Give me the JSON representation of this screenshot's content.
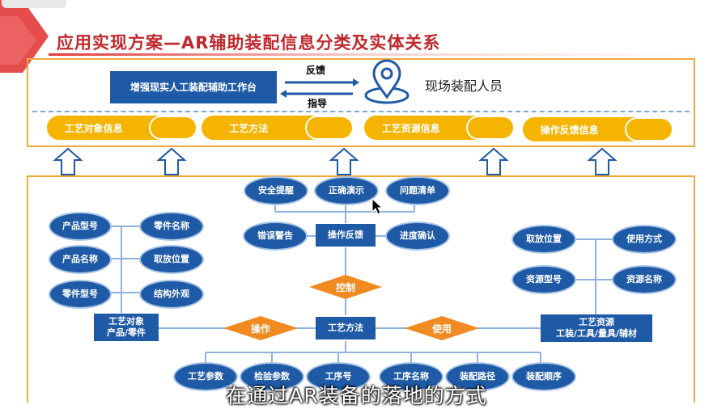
{
  "slide": {
    "title": "应用实现方案—AR辅助装配信息分类及实体关系",
    "subtitle": "在通过AR装备的落地的方式"
  },
  "top": {
    "workstation": "增强现实人工装配辅助工作台",
    "feedback": "反馈",
    "guide": "指导",
    "personnel": "现场装配人员",
    "pills": [
      "工艺对象信息",
      "工艺方法",
      "工艺资源信息",
      "操作反馈信息"
    ]
  },
  "feedback_cluster": {
    "center": "操作反馈",
    "safety": [
      "安全",
      "提醒"
    ],
    "demo": [
      "正确",
      "演示"
    ],
    "issues": [
      "问题",
      "清单"
    ],
    "error": [
      "错误",
      "警告"
    ],
    "progress": [
      "进度",
      "确认"
    ]
  },
  "object_cluster": {
    "center": [
      "工艺对象",
      "产品/零件"
    ],
    "product_model": [
      "产品",
      "型号"
    ],
    "product_name": [
      "产品",
      "名称"
    ],
    "part_model": [
      "零件",
      "型号"
    ],
    "part_name": [
      "零件",
      "名称"
    ],
    "pick_position": [
      "取放",
      "位置"
    ],
    "structure": [
      "结构",
      "外观"
    ]
  },
  "resource_cluster": {
    "center": [
      "工艺资源",
      "工装/工具/量具/辅材"
    ],
    "pick_position": [
      "取放",
      "位置"
    ],
    "usage": [
      "使用",
      "方式"
    ],
    "resource_model": [
      "资源",
      "型号"
    ],
    "resource_name": [
      "资源",
      "名称"
    ]
  },
  "method_cluster": {
    "center": "工艺方法",
    "control": "控制",
    "operate": "操作",
    "use": "使用",
    "process_params": [
      "工艺",
      "参数"
    ],
    "inspect_params": [
      "检验",
      "参数"
    ],
    "step_no": "工序号",
    "step_name": [
      "工序",
      "名称"
    ],
    "path": [
      "装配",
      "路径"
    ],
    "order": [
      "装配",
      "顺序"
    ]
  }
}
